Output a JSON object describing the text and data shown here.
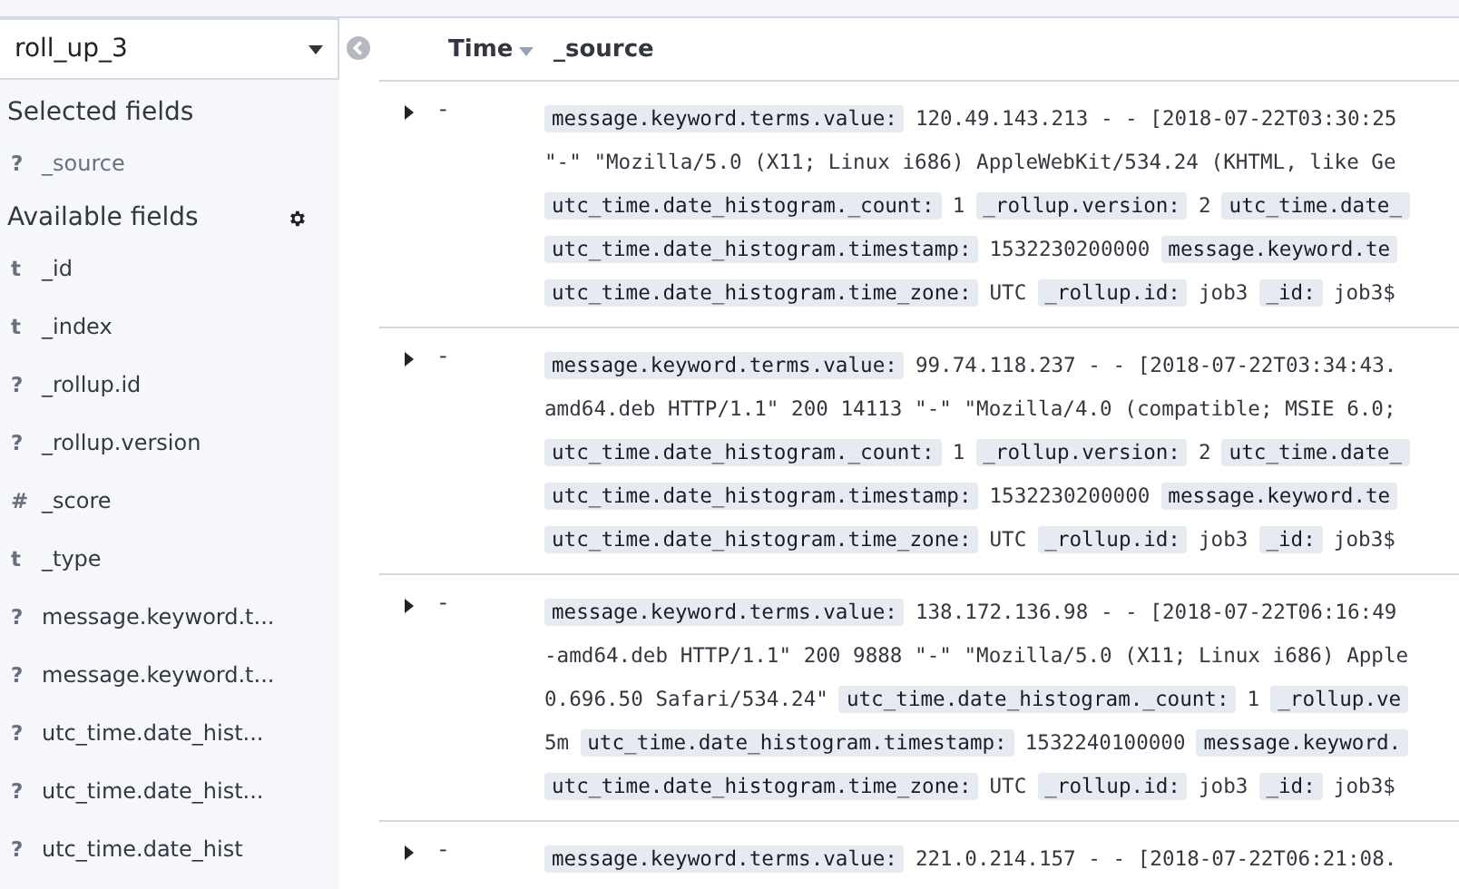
{
  "index_pattern": {
    "value": "roll_up_3"
  },
  "sidebar": {
    "selected_heading": "Selected fields",
    "selected_fields": [
      {
        "type_icon": "?",
        "name": "_source"
      }
    ],
    "available_heading": "Available fields",
    "available_fields": [
      {
        "type_icon": "t",
        "name": "_id"
      },
      {
        "type_icon": "t",
        "name": "_index"
      },
      {
        "type_icon": "?",
        "name": "_rollup.id"
      },
      {
        "type_icon": "?",
        "name": "_rollup.version"
      },
      {
        "type_icon": "#",
        "name": "_score"
      },
      {
        "type_icon": "t",
        "name": "_type"
      },
      {
        "type_icon": "?",
        "name": "message.keyword.t..."
      },
      {
        "type_icon": "?",
        "name": "message.keyword.t..."
      },
      {
        "type_icon": "?",
        "name": "utc_time.date_hist..."
      },
      {
        "type_icon": "?",
        "name": "utc_time.date_hist..."
      },
      {
        "type_icon": "?",
        "name": "utc_time.date_hist"
      }
    ]
  },
  "table": {
    "columns": [
      {
        "label": "Time",
        "sorted": true
      },
      {
        "label": "_source",
        "sorted": false
      }
    ],
    "rows": [
      {
        "expanded": false,
        "time": "-",
        "lines": [
          [
            {
              "kind": "key",
              "text": "message.keyword.terms.value:"
            },
            {
              "kind": "value",
              "text": "120.49.143.213 - - [2018-07-22T03:30:25"
            }
          ],
          [
            {
              "kind": "value",
              "text": "\"-\" \"Mozilla/5.0 (X11; Linux i686) AppleWebKit/534.24 (KHTML, like Ge"
            }
          ],
          [
            {
              "kind": "key",
              "text": "utc_time.date_histogram._count:"
            },
            {
              "kind": "value",
              "text": "1"
            },
            {
              "kind": "key",
              "text": "_rollup.version:"
            },
            {
              "kind": "value",
              "text": "2"
            },
            {
              "kind": "key",
              "text": "utc_time.date_"
            }
          ],
          [
            {
              "kind": "key",
              "text": "utc_time.date_histogram.timestamp:"
            },
            {
              "kind": "value",
              "text": "1532230200000"
            },
            {
              "kind": "key",
              "text": "message.keyword.te"
            }
          ],
          [
            {
              "kind": "key",
              "text": "utc_time.date_histogram.time_zone:"
            },
            {
              "kind": "value",
              "text": "UTC"
            },
            {
              "kind": "key",
              "text": "_rollup.id:"
            },
            {
              "kind": "value",
              "text": "job3"
            },
            {
              "kind": "key",
              "text": "_id:"
            },
            {
              "kind": "value",
              "text": "job3$"
            }
          ]
        ]
      },
      {
        "expanded": false,
        "time": "-",
        "lines": [
          [
            {
              "kind": "key",
              "text": "message.keyword.terms.value:"
            },
            {
              "kind": "value",
              "text": "99.74.118.237 - - [2018-07-22T03:34:43."
            }
          ],
          [
            {
              "kind": "value",
              "text": "amd64.deb HTTP/1.1\" 200 14113 \"-\" \"Mozilla/4.0 (compatible; MSIE 6.0;"
            }
          ],
          [
            {
              "kind": "key",
              "text": "utc_time.date_histogram._count:"
            },
            {
              "kind": "value",
              "text": "1"
            },
            {
              "kind": "key",
              "text": "_rollup.version:"
            },
            {
              "kind": "value",
              "text": "2"
            },
            {
              "kind": "key",
              "text": "utc_time.date_"
            }
          ],
          [
            {
              "kind": "key",
              "text": "utc_time.date_histogram.timestamp:"
            },
            {
              "kind": "value",
              "text": "1532230200000"
            },
            {
              "kind": "key",
              "text": "message.keyword.te"
            }
          ],
          [
            {
              "kind": "key",
              "text": "utc_time.date_histogram.time_zone:"
            },
            {
              "kind": "value",
              "text": "UTC"
            },
            {
              "kind": "key",
              "text": "_rollup.id:"
            },
            {
              "kind": "value",
              "text": "job3"
            },
            {
              "kind": "key",
              "text": "_id:"
            },
            {
              "kind": "value",
              "text": "job3$"
            }
          ]
        ]
      },
      {
        "expanded": false,
        "time": "-",
        "lines": [
          [
            {
              "kind": "key",
              "text": "message.keyword.terms.value:"
            },
            {
              "kind": "value",
              "text": "138.172.136.98 - - [2018-07-22T06:16:49"
            }
          ],
          [
            {
              "kind": "value",
              "text": "-amd64.deb HTTP/1.1\" 200 9888 \"-\" \"Mozilla/5.0 (X11; Linux i686) Apple"
            }
          ],
          [
            {
              "kind": "value",
              "text": "0.696.50 Safari/534.24\""
            },
            {
              "kind": "key",
              "text": "utc_time.date_histogram._count:"
            },
            {
              "kind": "value",
              "text": "1"
            },
            {
              "kind": "key",
              "text": "_rollup.ve"
            }
          ],
          [
            {
              "kind": "value",
              "text": "5m"
            },
            {
              "kind": "key",
              "text": "utc_time.date_histogram.timestamp:"
            },
            {
              "kind": "value",
              "text": "1532240100000"
            },
            {
              "kind": "key",
              "text": "message.keyword."
            }
          ],
          [
            {
              "kind": "key",
              "text": "utc_time.date_histogram.time_zone:"
            },
            {
              "kind": "value",
              "text": "UTC"
            },
            {
              "kind": "key",
              "text": "_rollup.id:"
            },
            {
              "kind": "value",
              "text": "job3"
            },
            {
              "kind": "key",
              "text": "_id:"
            },
            {
              "kind": "value",
              "text": "job3$"
            }
          ]
        ]
      },
      {
        "expanded": false,
        "time": "-",
        "lines": [
          [
            {
              "kind": "key",
              "text": "message.keyword.terms.value:"
            },
            {
              "kind": "value",
              "text": "221.0.214.157 - - [2018-07-22T06:21:08."
            }
          ]
        ]
      }
    ]
  }
}
